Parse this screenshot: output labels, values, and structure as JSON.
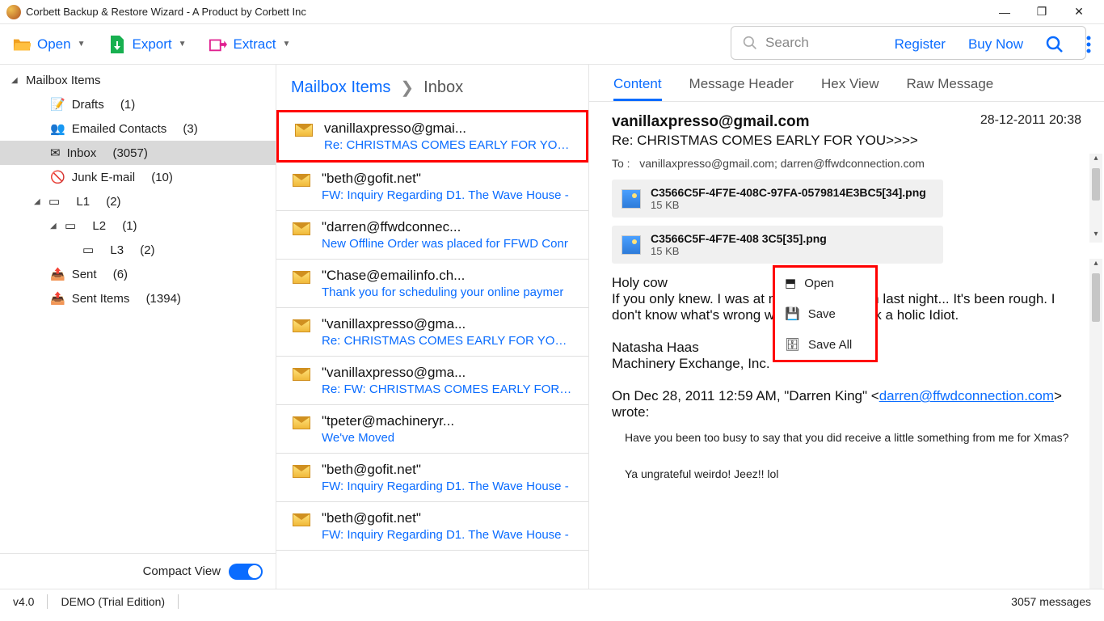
{
  "window": {
    "title": "Corbett Backup & Restore Wizard - A Product by Corbett Inc"
  },
  "toolbar": {
    "open": "Open",
    "export": "Export",
    "extract": "Extract",
    "register": "Register",
    "buy": "Buy Now"
  },
  "tree": {
    "root": "Mailbox Items",
    "items": [
      {
        "label": "Drafts",
        "count": "(1)"
      },
      {
        "label": "Emailed Contacts",
        "count": "(3)"
      },
      {
        "label": "Inbox",
        "count": "(3057)"
      },
      {
        "label": "Junk E-mail",
        "count": "(10)"
      },
      {
        "label": "L1",
        "count": "(2)"
      },
      {
        "label": "L2",
        "count": "(1)"
      },
      {
        "label": "L3",
        "count": "(2)"
      },
      {
        "label": "Sent",
        "count": "(6)"
      },
      {
        "label": "Sent Items",
        "count": "(1394)"
      }
    ],
    "compact": "Compact View"
  },
  "breadcrumb": {
    "a": "Mailbox Items",
    "b": "Inbox"
  },
  "search": {
    "placeholder": "Search"
  },
  "emails": [
    {
      "from": "vanillaxpresso@gmai...",
      "sub": "Re: CHRISTMAS COMES EARLY FOR YOU>>>"
    },
    {
      "from": "\"beth@gofit.net\"",
      "sub": "FW: Inquiry Regarding D1. The Wave House -"
    },
    {
      "from": "\"darren@ffwdconnec...",
      "sub": "New Offline Order was placed for FFWD Conr"
    },
    {
      "from": "\"Chase@emailinfo.ch...",
      "sub": "Thank you for scheduling your online paymer"
    },
    {
      "from": "\"vanillaxpresso@gma...",
      "sub": "Re: CHRISTMAS COMES EARLY FOR YOU>>>"
    },
    {
      "from": "\"vanillaxpresso@gma...",
      "sub": "Re: FW: CHRISTMAS COMES EARLY FOR YOU>"
    },
    {
      "from": "\"tpeter@machineryr...",
      "sub": "We've Moved"
    },
    {
      "from": "\"beth@gofit.net\"",
      "sub": "FW: Inquiry Regarding D1. The Wave House -"
    },
    {
      "from": "\"beth@gofit.net\"",
      "sub": "FW: Inquiry Regarding D1. The Wave House -"
    }
  ],
  "tabs": {
    "content": "Content",
    "header": "Message Header",
    "hex": "Hex View",
    "raw": "Raw Message"
  },
  "preview": {
    "from": "vanillaxpresso@gmail.com",
    "subject": "Re: CHRISTMAS COMES EARLY FOR YOU>>>>",
    "date": "28-12-2011 20:38",
    "to_label": "To :",
    "to": "vanillaxpresso@gmail.com; darren@ffwdconnection.com",
    "attachments": [
      {
        "name": "C3566C5F-4F7E-408C-97FA-0579814E3BC5[34].png",
        "size": "15 KB"
      },
      {
        "name": "C3566C5F-4F7E-408                                       3C5[35].png",
        "size": "15 KB"
      }
    ],
    "context": {
      "open": "Open",
      "save": "Save",
      "saveall": "Save All"
    },
    "body1": "Holy cow",
    "body2": "If you only knew. I was at my desk until 9pm last night... It's been rough. I don't know what's wrong with me. I'm a work a holic Idiot.",
    "sig1": "Natasha Haas",
    "sig2": "Machinery Exchange, Inc.",
    "quote_intro1": "On Dec 28, 2011 12:59 AM, \"Darren King\" <",
    "quote_link": "darren@ffwdconnection.com",
    "quote_intro2": "> wrote:",
    "q1": "Have you been too busy to say that you did receive a little something from me for Xmas?",
    "q2": "Ya ungrateful weirdo! Jeez!!  lol"
  },
  "status": {
    "ver": "v4.0",
    "edition": "DEMO (Trial Edition)",
    "msgs": "3057  messages"
  }
}
